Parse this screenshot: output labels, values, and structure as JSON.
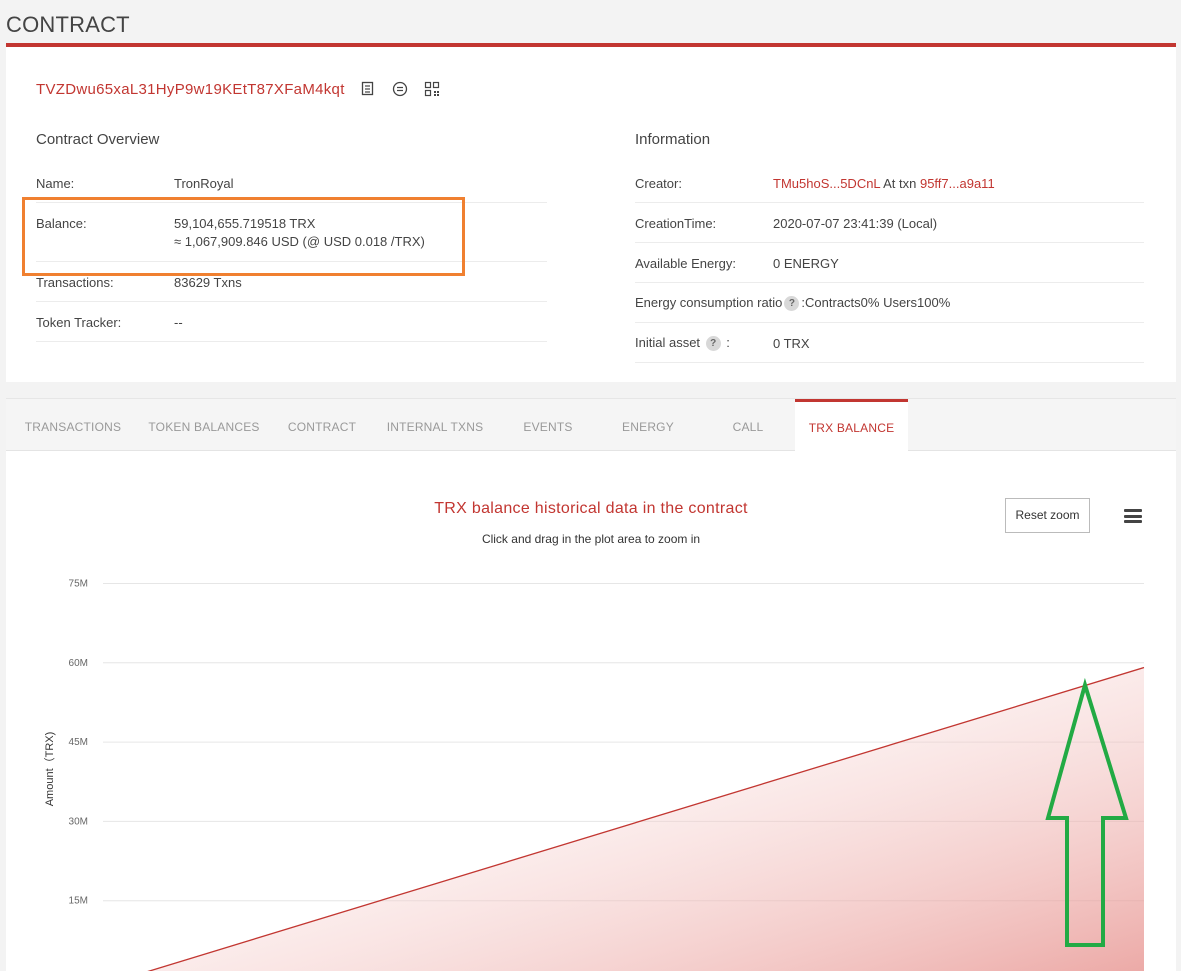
{
  "page": {
    "title": "CONTRACT"
  },
  "address": {
    "text": "TVZDwu65xaL31HyP9w19KEtT87XFaM4kqt",
    "icons": [
      "copy-icon",
      "message-icon",
      "qr-code-icon"
    ]
  },
  "overview": {
    "title": "Contract Overview",
    "name_label": "Name:",
    "name_value": "TronRoyal",
    "balance_label": "Balance:",
    "balance_trx": "59,104,655.719518 TRX",
    "balance_usd": "≈ 1,067,909.846 USD (@ USD 0.018 /TRX)",
    "transactions_label": "Transactions:",
    "transactions_value": "83629  Txns",
    "token_tracker_label": "Token Tracker:",
    "token_tracker_value": "--"
  },
  "information": {
    "title": "Information",
    "creator_label": "Creator:",
    "creator_address": "TMu5hoS...5DCnL",
    "creator_at_txn": "At txn",
    "creator_txn": "95ff7...a9a11",
    "creation_time_label": "CreationTime:",
    "creation_time_value": "2020-07-07 23:41:39 (Local)",
    "energy_label": "Available Energy:",
    "energy_value": "0  ENERGY",
    "ratio_label": "Energy consumption ratio",
    "ratio_value": ":Contracts0%  Users100%",
    "initial_asset_label": "Initial asset",
    "initial_asset_colon": ":",
    "initial_asset_value": "0 TRX",
    "help_glyph": "?"
  },
  "tabs": [
    {
      "label": "TRANSACTIONS"
    },
    {
      "label": "TOKEN BALANCES"
    },
    {
      "label": "CONTRACT"
    },
    {
      "label": "INTERNAL TXNS"
    },
    {
      "label": "EVENTS"
    },
    {
      "label": "ENERGY"
    },
    {
      "label": "CALL"
    },
    {
      "label": "TRX BALANCE",
      "active": true
    }
  ],
  "chart": {
    "title": "TRX balance historical data in the contract",
    "subtitle": "Click and drag in the plot area to zoom in",
    "reset_zoom_label": "Reset zoom",
    "menu_icon": "hamburger-menu-icon"
  },
  "colors": {
    "accent": "#c23631",
    "highlight_box": "#f08030",
    "arrow": "#22aa44"
  },
  "chart_data": {
    "type": "area",
    "title": "TRX balance historical data in the contract",
    "subtitle": "Click and drag in the plot area to zoom in",
    "xlabel": "",
    "ylabel": "Amount（TRX)",
    "y_tick_labels": [
      "15M",
      "30M",
      "45M",
      "60M",
      "75M"
    ],
    "y_ticks": [
      15000000,
      30000000,
      45000000,
      60000000,
      75000000
    ],
    "ylim": [
      0,
      75000000
    ],
    "grid": true,
    "series": [
      {
        "values": [
          0,
          59104655.719518
        ]
      }
    ]
  }
}
